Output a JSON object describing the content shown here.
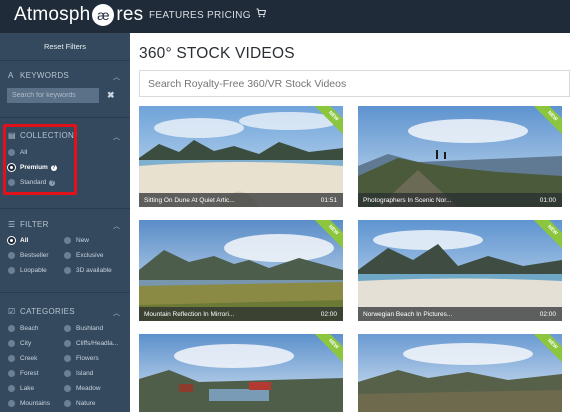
{
  "header": {
    "logo_text_a": "Atmosph",
    "logo_ae": "æ",
    "logo_text_b": "res",
    "nav_features": "FEATURES",
    "nav_pricing": "PRICING",
    "cart_icon": "cart-icon"
  },
  "sidebar": {
    "reset_label": "Reset Filters",
    "keywords": {
      "heading": "KEYWORDS",
      "placeholder": "Search for keywords",
      "clear_symbol": "✖"
    },
    "collection": {
      "heading": "COLLECTION",
      "options": [
        "All",
        "Premium",
        "Standard"
      ],
      "selected": "Premium"
    },
    "filter": {
      "heading": "FILTER",
      "options": [
        "All",
        "New",
        "Bestseller",
        "Exclusive",
        "Loopable",
        "3D available"
      ],
      "selected": "All"
    },
    "categories": {
      "heading": "CATEGORIES",
      "options": [
        "Beach",
        "Bushland",
        "City",
        "Cliffs/Headla...",
        "Creek",
        "Flowers",
        "Forest",
        "Island",
        "Lake",
        "Meadow",
        "Mountains",
        "Nature"
      ]
    }
  },
  "main": {
    "title": "360° STOCK VIDEOS",
    "search_placeholder": "Search Royalty-Free 360/VR Stock Videos",
    "videos": [
      {
        "title": "Sitting On Dune At Quiet Artic...",
        "duration": "01:51",
        "badge": "NEW"
      },
      {
        "title": "Photographers In Scenic Nor...",
        "duration": "01:00",
        "badge": "NEW"
      },
      {
        "title": "Mountain Reflection In Mirrori...",
        "duration": "02:00",
        "badge": "NEW"
      },
      {
        "title": "Norwegian Beach In Pictures...",
        "duration": "02:00",
        "badge": "NEW"
      },
      {
        "title": "",
        "duration": "",
        "badge": "NEW"
      },
      {
        "title": "",
        "duration": "",
        "badge": "NEW"
      }
    ]
  },
  "colors": {
    "topbar": "#1f2b38",
    "sidebar": "#34495e",
    "badge": "#8cc63f",
    "highlight": "#e2121b"
  }
}
